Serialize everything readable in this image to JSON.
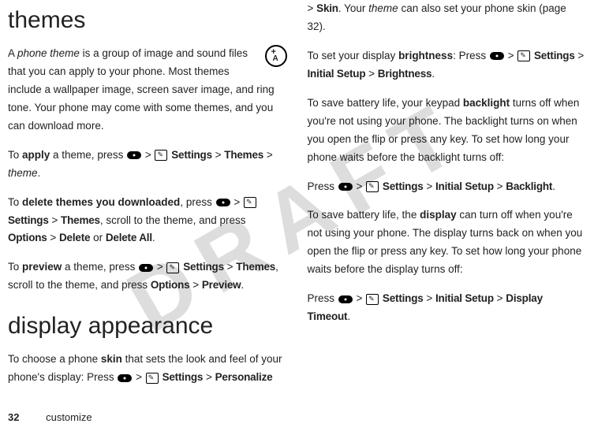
{
  "watermark": "DRAFT",
  "left": {
    "h1_themes": "themes",
    "p_theme_intro_a": "A ",
    "p_theme_intro_b": "phone theme",
    "p_theme_intro_c": " is a group of image and sound files that you can apply to your phone. Most themes include a wallpaper image, screen saver image, and ring tone. Your phone may come with some themes, and you can download more.",
    "p_apply_a": "To ",
    "p_apply_b": "apply",
    "p_apply_c": " a theme, press ",
    "p_apply_d": "Settings",
    "p_apply_e": "Themes",
    "p_apply_f": "theme",
    "p_delete_a": "To ",
    "p_delete_b": "delete themes you downloaded",
    "p_delete_c": ", press ",
    "p_delete_d": "Settings",
    "p_delete_e": "Themes",
    "p_delete_f": ", scroll to the theme, and press ",
    "p_delete_g": "Options",
    "p_delete_h": "Delete",
    "p_delete_i": " or ",
    "p_delete_j": "Delete All",
    "p_preview_a": "To ",
    "p_preview_b": "preview",
    "p_preview_c": " a theme, press ",
    "p_preview_d": "Settings",
    "p_preview_e": "Themes",
    "p_preview_f": ", scroll to the theme, and press ",
    "p_preview_g": "Options",
    "p_preview_h": "Preview",
    "h1_display": "display appearance",
    "p_skin_a": "To choose a phone ",
    "p_skin_b": "skin",
    "p_skin_c": " that sets the look and feel of your phone's display: Press ",
    "p_skin_d": "Settings",
    "p_skin_e": "Personalize"
  },
  "right": {
    "p_skin2_a": "Skin",
    "p_skin2_b": ". Your ",
    "p_skin2_c": "theme",
    "p_skin2_d": " can also set your phone skin (page 32).",
    "p_bright_a": "To set your display ",
    "p_bright_b": "brightness",
    "p_bright_c": ": Press ",
    "p_bright_d": "Settings",
    "p_bright_e": "Initial Setup",
    "p_bright_f": "Brightness",
    "p_backlight_a": "To save battery life, your keypad ",
    "p_backlight_b": "backlight",
    "p_backlight_c": " turns off when you're not using your phone. The backlight turns on when you open the flip or press any key. To set how long your phone waits before the backlight turns off:",
    "p_backlight_press_a": "Press ",
    "p_backlight_press_b": "Settings",
    "p_backlight_press_c": "Initial Setup",
    "p_backlight_press_d": "Backlight",
    "p_display_a": "To save battery life, the ",
    "p_display_b": "display",
    "p_display_c": " can turn off when you're not using your phone. The display turns back on when you open the flip or press any key. To set how long your phone waits before the display turns off:",
    "p_display_press_a": "Press ",
    "p_display_press_b": "Settings",
    "p_display_press_c": "Initial Setup",
    "p_display_press_d": "Display Timeout"
  },
  "footer": {
    "page": "32",
    "section": "customize"
  },
  "gt": " > "
}
